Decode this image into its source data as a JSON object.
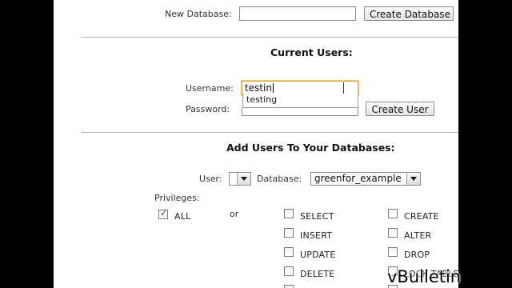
{
  "new_database": {
    "label": "New Database:",
    "input_value": "",
    "button_label": "Create Database"
  },
  "current_users": {
    "heading": "Current Users:",
    "username_label": "Username:",
    "username_value": "testin",
    "autocomplete_suggestion": "testing",
    "password_label": "Password:",
    "password_value": "",
    "button_label": "Create User"
  },
  "add_users": {
    "heading": "Add Users To Your Databases:",
    "user_label": "User:",
    "user_selected": "",
    "database_label": "Database:",
    "database_selected": "greenfor_example",
    "privileges_label": "Privileges:",
    "or_label": "or",
    "privileges": {
      "all": {
        "label": "ALL",
        "checked": true
      },
      "select": {
        "label": "SELECT",
        "checked": false
      },
      "insert": {
        "label": "INSERT",
        "checked": false
      },
      "update": {
        "label": "UPDATE",
        "checked": false
      },
      "delete": {
        "label": "DELETE",
        "checked": false
      },
      "create": {
        "label": "CREATE",
        "checked": false
      },
      "alter": {
        "label": "ALTER",
        "checked": false
      },
      "drop": {
        "label": "DROP",
        "checked": false
      },
      "lock_tables": {
        "label": "LOCK TABLES",
        "checked": false
      }
    }
  },
  "watermark": "vBulletin"
}
